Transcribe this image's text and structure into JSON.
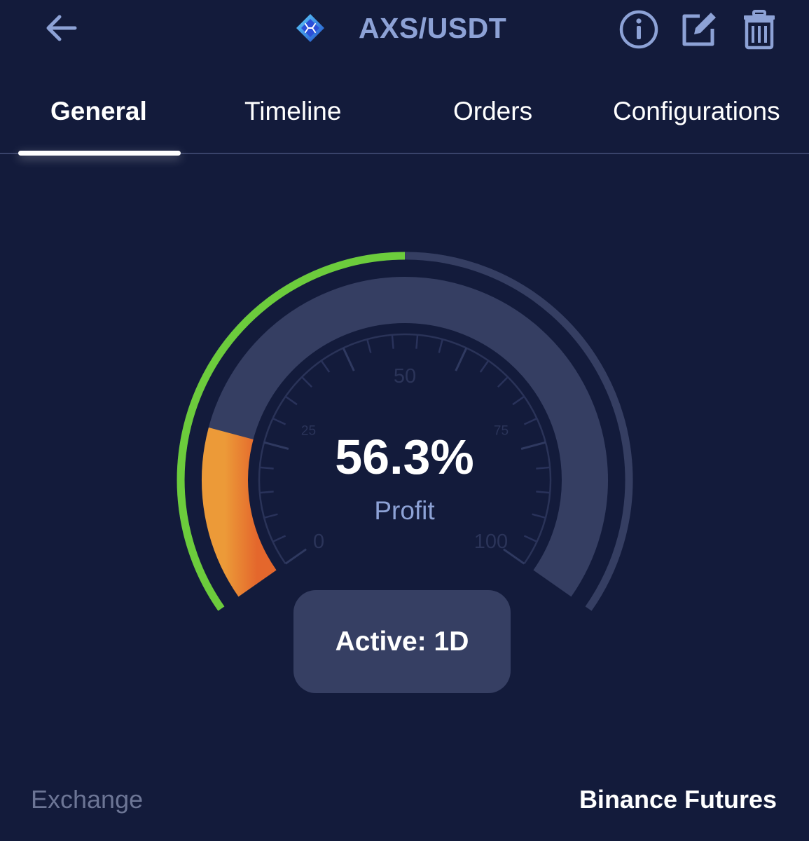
{
  "header": {
    "pair": "AXS/USDT",
    "coin_icon": "axie-infinity-coin-icon",
    "back_icon": "back-arrow-icon",
    "info_icon": "info-icon",
    "edit_icon": "edit-icon",
    "delete_icon": "trash-icon"
  },
  "tabs": [
    {
      "label": "General",
      "active": true
    },
    {
      "label": "Timeline",
      "active": false
    },
    {
      "label": "Orders",
      "active": false
    },
    {
      "label": "Configurations",
      "active": false
    }
  ],
  "gauge": {
    "value_text": "56.3%",
    "label": "Profit",
    "outer_progress_fraction": 0.5,
    "inner_fill_fraction": 0.2,
    "scale_labels": [
      "0",
      "25",
      "50",
      "75",
      "100"
    ],
    "colors": {
      "background": "#131b3b",
      "track": "#353e62",
      "outer_progress": "#6ccc3c",
      "inner_fill_start": "#ec9a38",
      "inner_fill_end": "#e4672c",
      "accent_text": "#8da2d6"
    }
  },
  "status": {
    "active_label": "Active: 1D"
  },
  "details": {
    "exchange_label": "Exchange",
    "exchange_value": "Binance Futures"
  }
}
